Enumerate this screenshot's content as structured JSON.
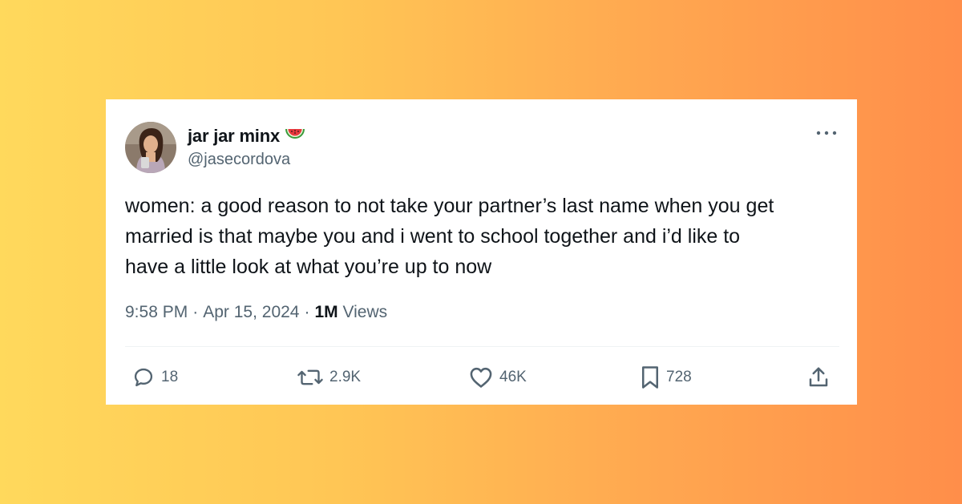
{
  "theme": {
    "text_primary": "#0f1419",
    "text_secondary": "#536471",
    "card_background": "#ffffff",
    "background_gradient": [
      "#ffd95c",
      "#ff8e4a"
    ]
  },
  "author": {
    "display_name": "jar jar minx",
    "name_emoji_icon": "watermelon-icon",
    "handle": "@jasecordova",
    "avatar": "avatar-photo"
  },
  "tweet": {
    "text": "women: a good reason to not take your partner’s last name when you get\nmarried is that maybe you and i went to school together and i’d like to\nhave a little look at what you’re up to now",
    "time": "9:58 PM",
    "separator": "·",
    "date": "Apr 15, 2024",
    "views_count": "1M",
    "views_label": "Views"
  },
  "actions": {
    "reply": {
      "icon": "reply-icon",
      "count": "18"
    },
    "repost": {
      "icon": "repost-icon",
      "count": "2.9K"
    },
    "like": {
      "icon": "heart-icon",
      "count": "46K"
    },
    "bookmark": {
      "icon": "bookmark-icon",
      "count": "728"
    },
    "share": {
      "icon": "share-icon"
    }
  },
  "more_menu_icon": "more-options-icon"
}
